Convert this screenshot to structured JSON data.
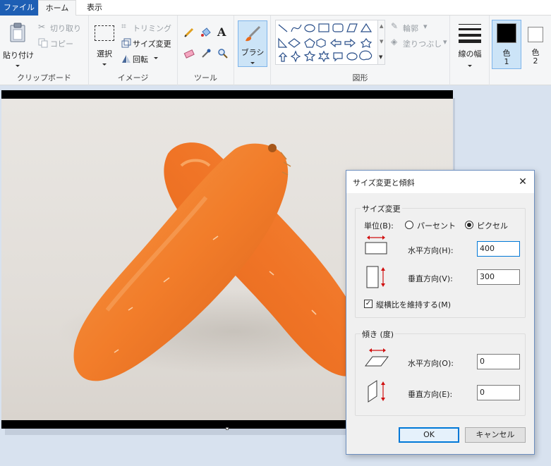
{
  "tabs": {
    "file": "ファイル",
    "home": "ホーム",
    "view": "表示"
  },
  "clipboard": {
    "paste": "貼り付け",
    "cut": "切り取り",
    "copy": "コピー",
    "group": "クリップボード"
  },
  "image": {
    "select": "選択",
    "crop": "トリミング",
    "resize": "サイズ変更",
    "rotate": "回転",
    "group": "イメージ"
  },
  "tools": {
    "group": "ツール"
  },
  "brush": {
    "label": "ブラシ"
  },
  "shapes": {
    "outline": "輪郭",
    "fill": "塗りつぶし",
    "group": "図形"
  },
  "size": {
    "label": "線の幅"
  },
  "colors": {
    "color1": "色",
    "color1_num": "1",
    "color2": "色",
    "color2_num": "2",
    "color1_hex": "#000000",
    "color2_hex": "#ffffff"
  },
  "dialog": {
    "title": "サイズ変更と傾斜",
    "close": "✕",
    "resize_group": "サイズ変更",
    "unit_label": "単位(B):",
    "unit_percent": "パーセント",
    "unit_pixel": "ピクセル",
    "horizontal_label": "水平方向(H):",
    "horizontal_value": "400",
    "vertical_label": "垂直方向(V):",
    "vertical_value": "300",
    "keep_ratio": "縦横比を維持する(M)",
    "skew_group": "傾き (度)",
    "skew_h_label": "水平方向(O):",
    "skew_h_value": "0",
    "skew_v_label": "垂直方向(E):",
    "skew_v_value": "0",
    "ok": "OK",
    "cancel": "キャンセル"
  },
  "accent": "#1e5fb4",
  "photo_subject": "carrot-photo"
}
